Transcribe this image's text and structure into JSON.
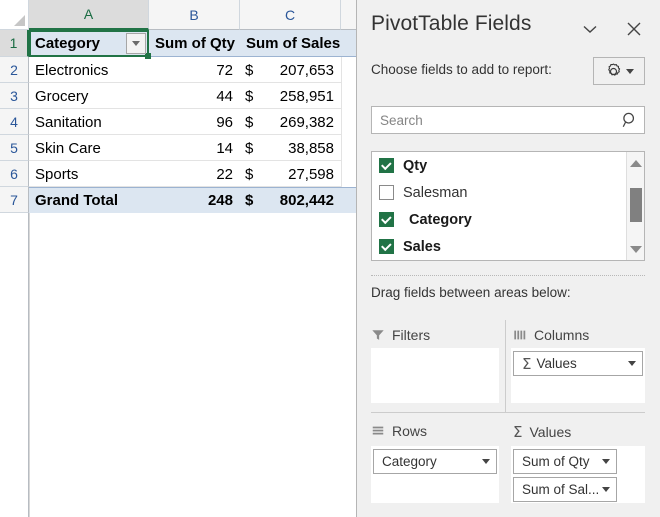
{
  "sheet": {
    "column_headers": [
      "A",
      "B",
      "C"
    ],
    "row_headers": [
      "1",
      "2",
      "3",
      "4",
      "5",
      "6",
      "7"
    ],
    "selected_column": "A",
    "selected_row": "1",
    "active_cell": "A1",
    "filter_button_icon": "filter-dropdown-icon",
    "table": {
      "headers": [
        "Category",
        "Sum of Qty",
        "Sum of Sales"
      ],
      "rows": [
        {
          "category": "Electronics",
          "qty": "72",
          "currency": "$",
          "sales": "207,653"
        },
        {
          "category": "Grocery",
          "qty": "44",
          "currency": "$",
          "sales": "258,951"
        },
        {
          "category": "Sanitation",
          "qty": "96",
          "currency": "$",
          "sales": "269,382"
        },
        {
          "category": "Skin Care",
          "qty": "14",
          "currency": "$",
          "sales": "38,858"
        },
        {
          "category": "Sports",
          "qty": "22",
          "currency": "$",
          "sales": "27,598"
        }
      ],
      "total": {
        "category": "Grand Total",
        "qty": "248",
        "currency": "$",
        "sales": "802,442"
      }
    }
  },
  "panel": {
    "title": "PivotTable Fields",
    "collapse_icon": "chevron-down-icon",
    "close_icon": "close-icon",
    "choose_label": "Choose fields to add to report:",
    "tools_icon": "gear-icon",
    "tools_chevron_icon": "chevron-down-icon",
    "search": {
      "value": "",
      "placeholder": "Search",
      "icon": "search-icon"
    },
    "fields": [
      {
        "label": "Qty",
        "checked": true,
        "indent": false
      },
      {
        "label": "Salesman",
        "checked": false,
        "indent": false
      },
      {
        "label": "Category",
        "checked": true,
        "indent": true
      },
      {
        "label": "Sales",
        "checked": true,
        "indent": false
      }
    ],
    "list_scroll": {
      "up_icon": "scroll-up-arrow-icon",
      "down_icon": "scroll-down-arrow-icon"
    },
    "drag_label": "Drag fields between areas below:",
    "areas": {
      "filters": {
        "title": "Filters",
        "icon": "filter-funnel-icon",
        "items": []
      },
      "columns": {
        "title": "Columns",
        "icon": "columns-icon",
        "items": [
          {
            "label": "Values",
            "sigma": "Σ",
            "chevron_icon": "chevron-down-icon"
          }
        ]
      },
      "rows": {
        "title": "Rows",
        "icon": "rows-icon",
        "items": [
          {
            "label": "Category",
            "chevron_icon": "chevron-down-icon"
          }
        ]
      },
      "values": {
        "title": "Values",
        "icon": "sigma-icon",
        "sigma": "Σ",
        "items": [
          {
            "label": "Sum of Qty",
            "chevron_icon": "chevron-down-icon"
          },
          {
            "label": "Sum of Sal...",
            "chevron_icon": "chevron-down-icon"
          }
        ]
      }
    },
    "values_scroll": {
      "up_icon": "scroll-up-arrow-icon",
      "down_icon": "scroll-down-arrow-icon"
    }
  },
  "colors": {
    "excel_green": "#217346",
    "header_blue": "#dce6f1",
    "panel_bg": "#f0f0f0",
    "header_text_blue": "#2a5699"
  }
}
